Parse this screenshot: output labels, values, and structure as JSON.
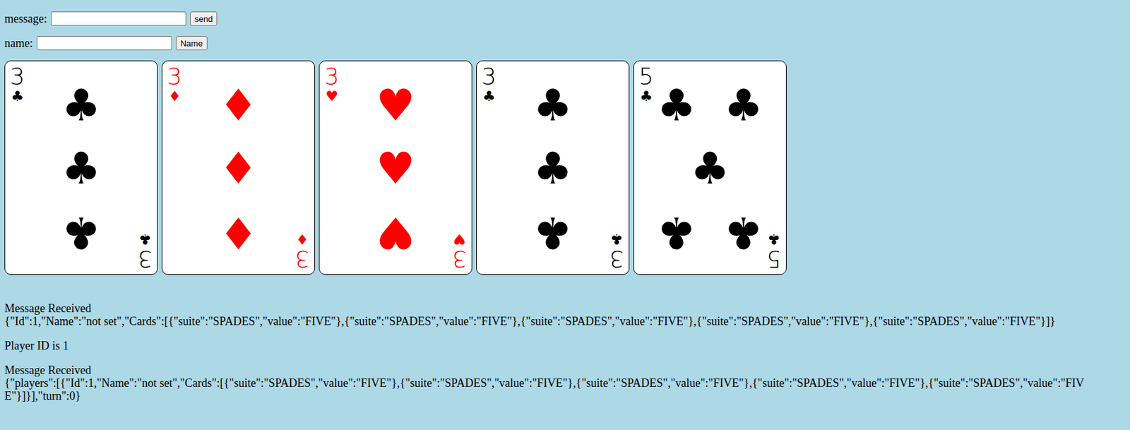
{
  "form": {
    "message": {
      "label": "message:",
      "button": "send"
    },
    "name": {
      "label": "name:",
      "button": "Name"
    }
  },
  "cards": [
    {
      "rank": "3",
      "suit": "♣",
      "color": "#000000"
    },
    {
      "rank": "3",
      "suit": "♦",
      "color": "#ff0000"
    },
    {
      "rank": "3",
      "suit": "♥",
      "color": "#ff0000"
    },
    {
      "rank": "3",
      "suit": "♣",
      "color": "#000000"
    },
    {
      "rank": "5",
      "suit": "♣",
      "color": "#000000"
    }
  ],
  "log": [
    {
      "kind": "received",
      "heading": "Message Received",
      "body": "{\"Id\":1,\"Name\":\"not set\",\"Cards\":[{\"suite\":\"SPADES\",\"value\":\"FIVE\"},{\"suite\":\"SPADES\",\"value\":\"FIVE\"},{\"suite\":\"SPADES\",\"value\":\"FIVE\"},{\"suite\":\"SPADES\",\"value\":\"FIVE\"},{\"suite\":\"SPADES\",\"value\":\"FIVE\"}]}"
    },
    {
      "kind": "info",
      "text": "Player ID is 1"
    },
    {
      "kind": "received",
      "heading": "Message Received",
      "body": "{\"players\":[{\"Id\":1,\"Name\":\"not set\",\"Cards\":[{\"suite\":\"SPADES\",\"value\":\"FIVE\"},{\"suite\":\"SPADES\",\"value\":\"FIVE\"},{\"suite\":\"SPADES\",\"value\":\"FIVE\"},{\"suite\":\"SPADES\",\"value\":\"FIVE\"},{\"suite\":\"SPADES\",\"value\":\"FIVE\"}]}],\"turn\":0}"
    }
  ]
}
